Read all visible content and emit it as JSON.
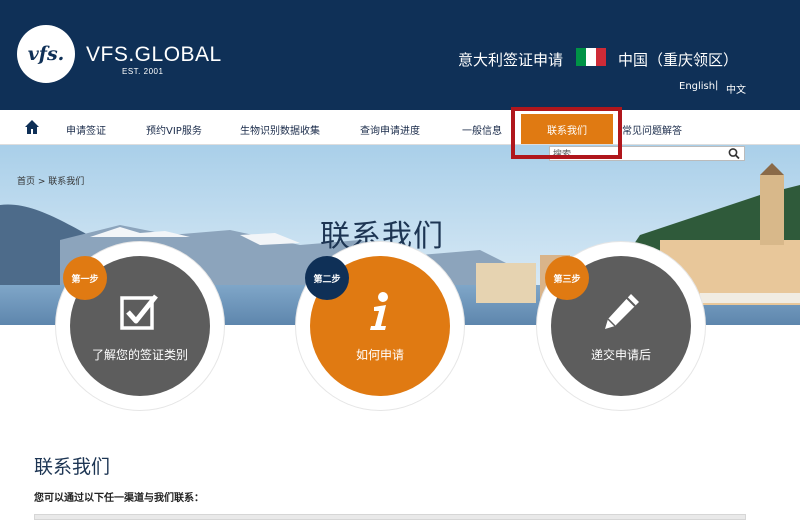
{
  "header": {
    "logo_text": "vfs.",
    "brand": "VFS.GLOBAL",
    "brand_est": "EST. 2001",
    "visa_title": "意大利签证申请",
    "country": "中国（重庆领区）",
    "lang_en": "English",
    "lang_zh": "中文",
    "flag_colors": [
      "#009246",
      "#ffffff",
      "#ce2b37"
    ]
  },
  "nav": {
    "items": [
      "申请签证",
      "预约VIP服务",
      "生物识别数据收集",
      "查询申请进度",
      "一般信息",
      "联系我们",
      "常见问题解答"
    ],
    "active_index": 5
  },
  "search": {
    "placeholder": "搜索"
  },
  "breadcrumb": "首页 > 联系我们",
  "hero_title": "联系我们",
  "steps": [
    {
      "badge": "第一步",
      "label": "了解您的签证类别",
      "icon": "checkbox-icon"
    },
    {
      "badge": "第二步",
      "label": "如何申请",
      "icon": "info-icon"
    },
    {
      "badge": "第三步",
      "label": "递交申请后",
      "icon": "pencil-icon"
    }
  ],
  "contact": {
    "title": "联系我们",
    "subtitle": "您可以通过以下任一渠道与我们联系："
  },
  "colors": {
    "navy": "#0f3057",
    "orange": "#e07a12",
    "grey": "#5d5d5d",
    "highlight": "#b0161c"
  }
}
